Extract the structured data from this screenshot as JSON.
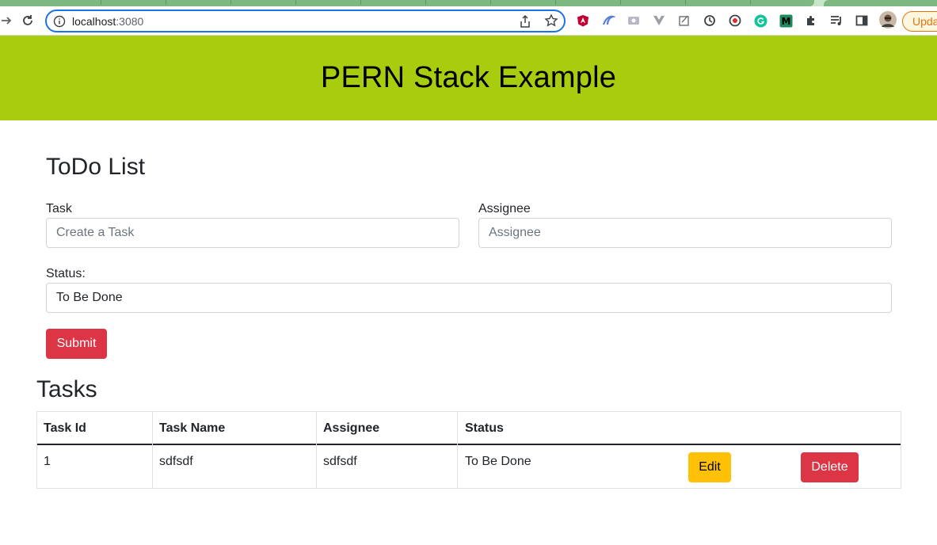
{
  "browser": {
    "url_host": "localhost",
    "url_port": ":3080",
    "update_label": "Upda",
    "extensions": [
      "angular-icon",
      "cursor-icon",
      "screen-icon",
      "vue-icon",
      "notes-icon",
      "sync-icon",
      "record-icon",
      "grammarly-icon",
      "m-icon",
      "puzzle-icon",
      "queue-icon",
      "sidepanel-icon",
      "profile-avatar"
    ]
  },
  "header": {
    "title": "PERN Stack Example"
  },
  "form": {
    "title": "ToDo List",
    "task_label": "Task",
    "task_placeholder": "Create a Task",
    "assignee_label": "Assignee",
    "assignee_placeholder": "Assignee",
    "status_label": "Status:",
    "status_value": "To Be Done",
    "submit_label": "Submit"
  },
  "tasks": {
    "title": "Tasks",
    "columns": [
      "Task Id",
      "Task Name",
      "Assignee",
      "Status"
    ],
    "rows": [
      {
        "id": "1",
        "name": "sdfsdf",
        "assignee": "sdfsdf",
        "status": "To Be Done",
        "edit_label": "Edit",
        "delete_label": "Delete"
      }
    ]
  },
  "colors": {
    "header_bg": "#a8cc0e",
    "danger": "#dc3545",
    "warning": "#ffc107"
  }
}
